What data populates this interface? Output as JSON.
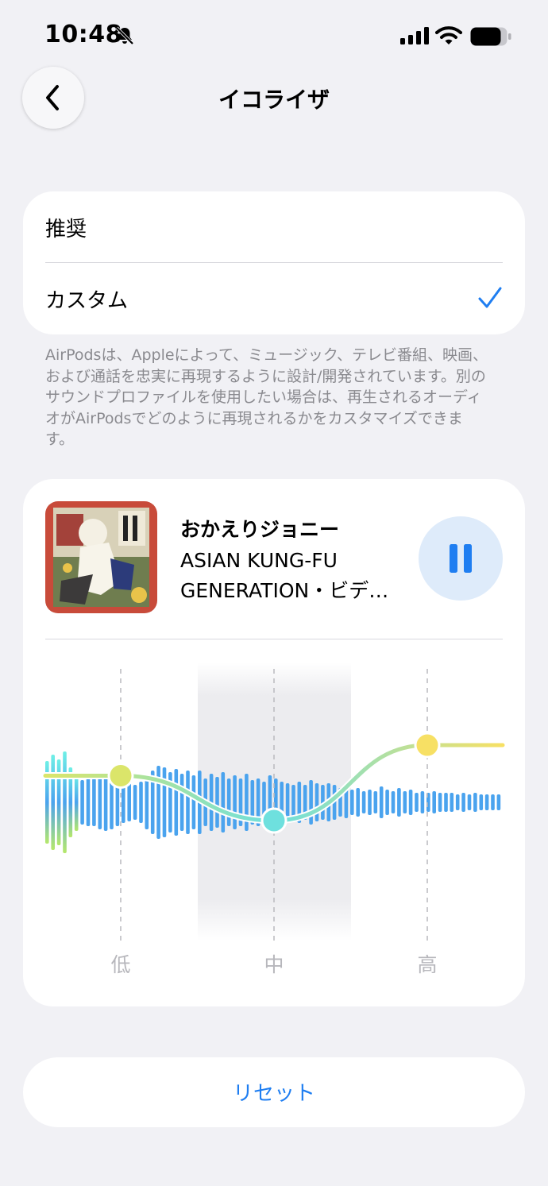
{
  "status_bar": {
    "time": "10:48",
    "icons": [
      "bell-slash-icon",
      "cellular-signal-icon",
      "wifi-icon",
      "battery-icon"
    ]
  },
  "header": {
    "back_icon": "chevron-left-icon",
    "title": "イコライザ"
  },
  "presets": {
    "items": [
      {
        "label": "推奨",
        "selected": false
      },
      {
        "label": "カスタム",
        "selected": true
      }
    ],
    "check_icon": "checkmark-icon"
  },
  "description": "AirPodsは、Appleによって、ミュージック、テレビ番組、映画、および通話を忠実に再現するように設計/開発されています。別のサウンドプロファイルを使用したい場合は、再生されるオーディオがAirPodsでどのように再現されるかをカスタマイズできます。",
  "now_playing": {
    "title": "おかえりジョニー",
    "artist": "ASIAN KUNG-FU GENERATION・ビデ…",
    "state": "playing",
    "control_icon": "pause-icon"
  },
  "equalizer": {
    "bands": [
      {
        "label": "低",
        "level": 0.58
      },
      {
        "label": "中",
        "level": 0.08
      },
      {
        "label": "高",
        "level": 0.92
      }
    ],
    "selected_band": "中"
  },
  "reset_label": "リセット",
  "colors": {
    "accent": "#1f7ef1",
    "background": "#f1f1f5",
    "eq_low": "#dbe56a",
    "eq_mid": "#6ee0de",
    "eq_high": "#f7e064",
    "spectrum": "#4aa3ee"
  }
}
